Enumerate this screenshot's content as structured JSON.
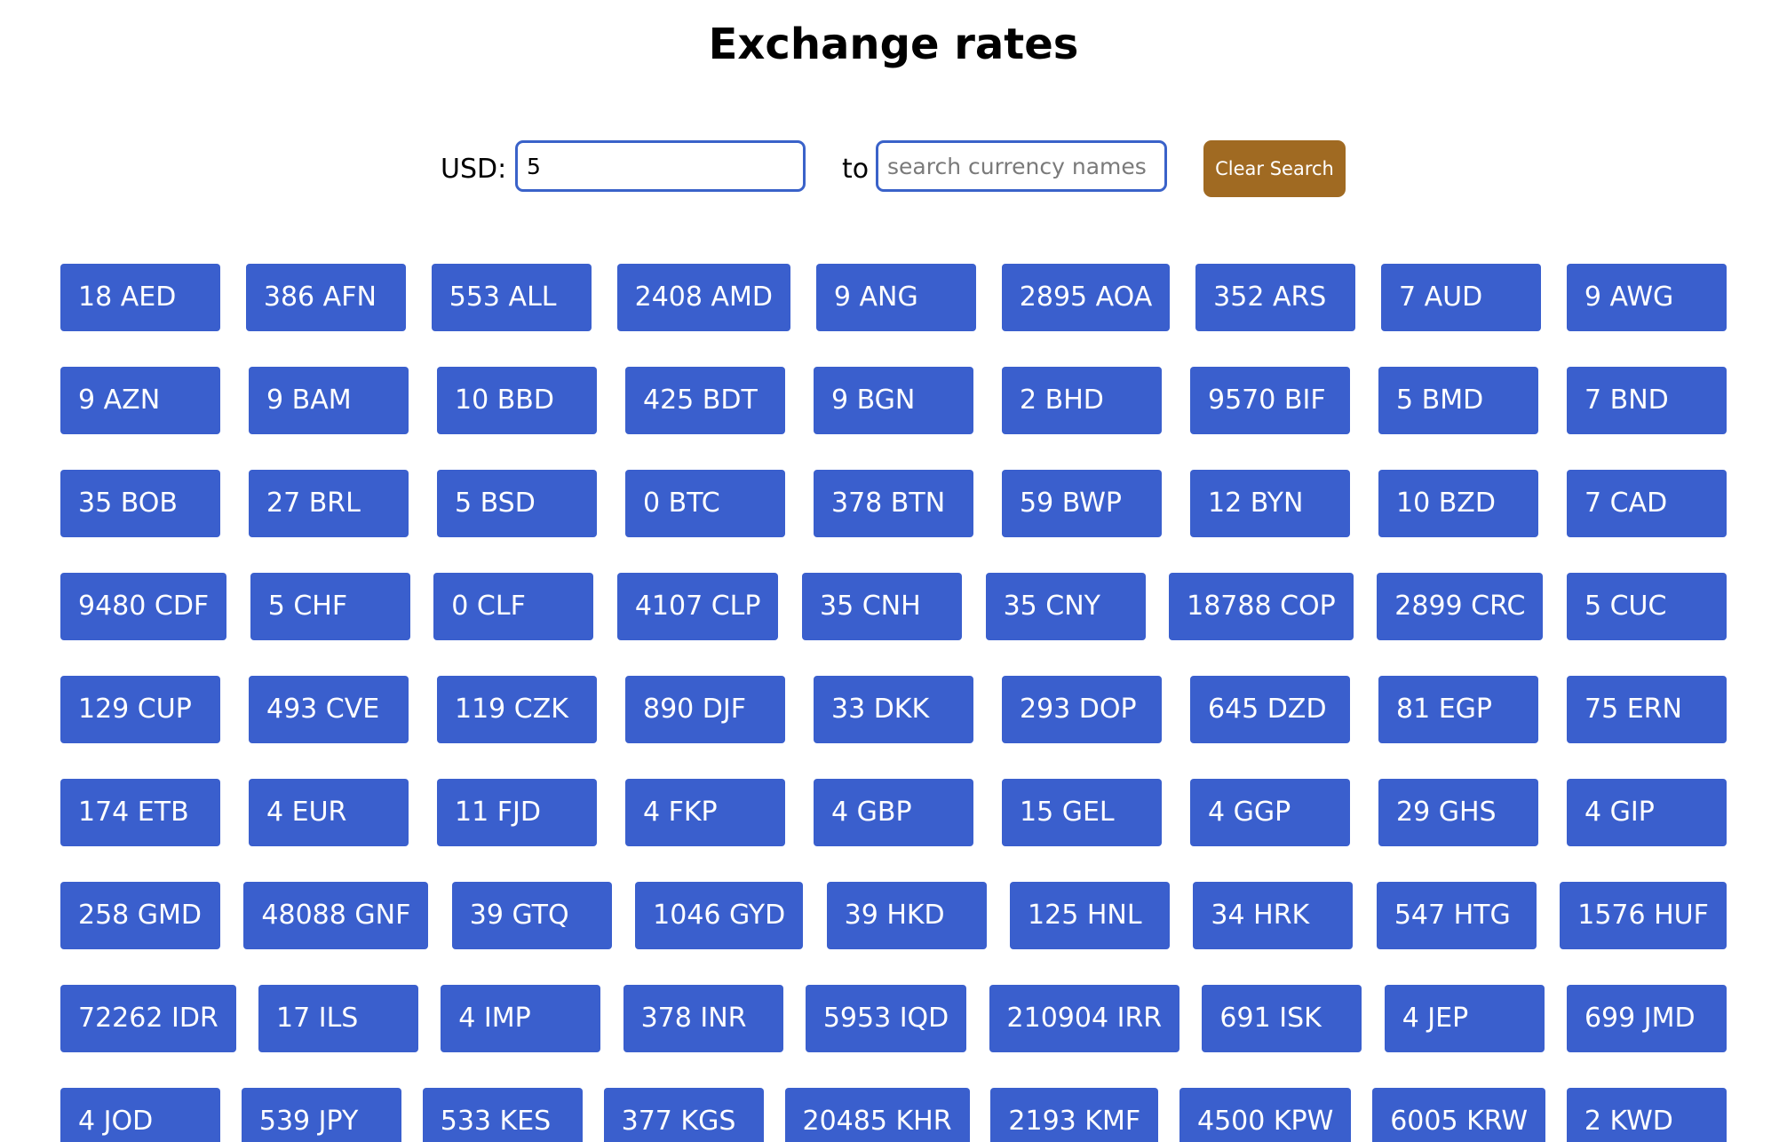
{
  "page": {
    "title": "Exchange rates"
  },
  "converter": {
    "base_label": "USD:",
    "amount_value": "5",
    "to_label": "to",
    "search_placeholder": "search currency names",
    "clear_label": "Clear Search"
  },
  "colors": {
    "chip_bg": "#3a5fcd",
    "input_border": "#3a62c9",
    "clear_bg": "#a06a22"
  },
  "rates": [
    [
      "18 AED",
      "386 AFN",
      "553 ALL",
      "2408 AMD",
      "9 ANG",
      "2895 AOA",
      "352 ARS",
      "7 AUD",
      "9 AWG"
    ],
    [
      "9 AZN",
      "9 BAM",
      "10 BBD",
      "425 BDT",
      "9 BGN",
      "2 BHD",
      "9570 BIF",
      "5 BMD",
      "7 BND"
    ],
    [
      "35 BOB",
      "27 BRL",
      "5 BSD",
      "0 BTC",
      "378 BTN",
      "59 BWP",
      "12 BYN",
      "10 BZD",
      "7 CAD"
    ],
    [
      "9480 CDF",
      "5 CHF",
      "0 CLF",
      "4107 CLP",
      "35 CNH",
      "35 CNY",
      "18788 COP",
      "2899 CRC",
      "5 CUC"
    ],
    [
      "129 CUP",
      "493 CVE",
      "119 CZK",
      "890 DJF",
      "33 DKK",
      "293 DOP",
      "645 DZD",
      "81 EGP",
      "75 ERN"
    ],
    [
      "174 ETB",
      "4 EUR",
      "11 FJD",
      "4 FKP",
      "4 GBP",
      "15 GEL",
      "4 GGP",
      "29 GHS",
      "4 GIP"
    ],
    [
      "258 GMD",
      "48088 GNF",
      "39 GTQ",
      "1046 GYD",
      "39 HKD",
      "125 HNL",
      "34 HRK",
      "547 HTG",
      "1576 HUF"
    ],
    [
      "72262 IDR",
      "17 ILS",
      "4 IMP",
      "378 INR",
      "5953 IQD",
      "210904 IRR",
      "691 ISK",
      "4 JEP",
      "699 JMD"
    ],
    [
      "4 JOD",
      "539 JPY",
      "533 KES",
      "377 KGS",
      "20485 KHR",
      "2193 KMF",
      "4500 KPW",
      "6005 KRW",
      "2 KWD"
    ]
  ]
}
